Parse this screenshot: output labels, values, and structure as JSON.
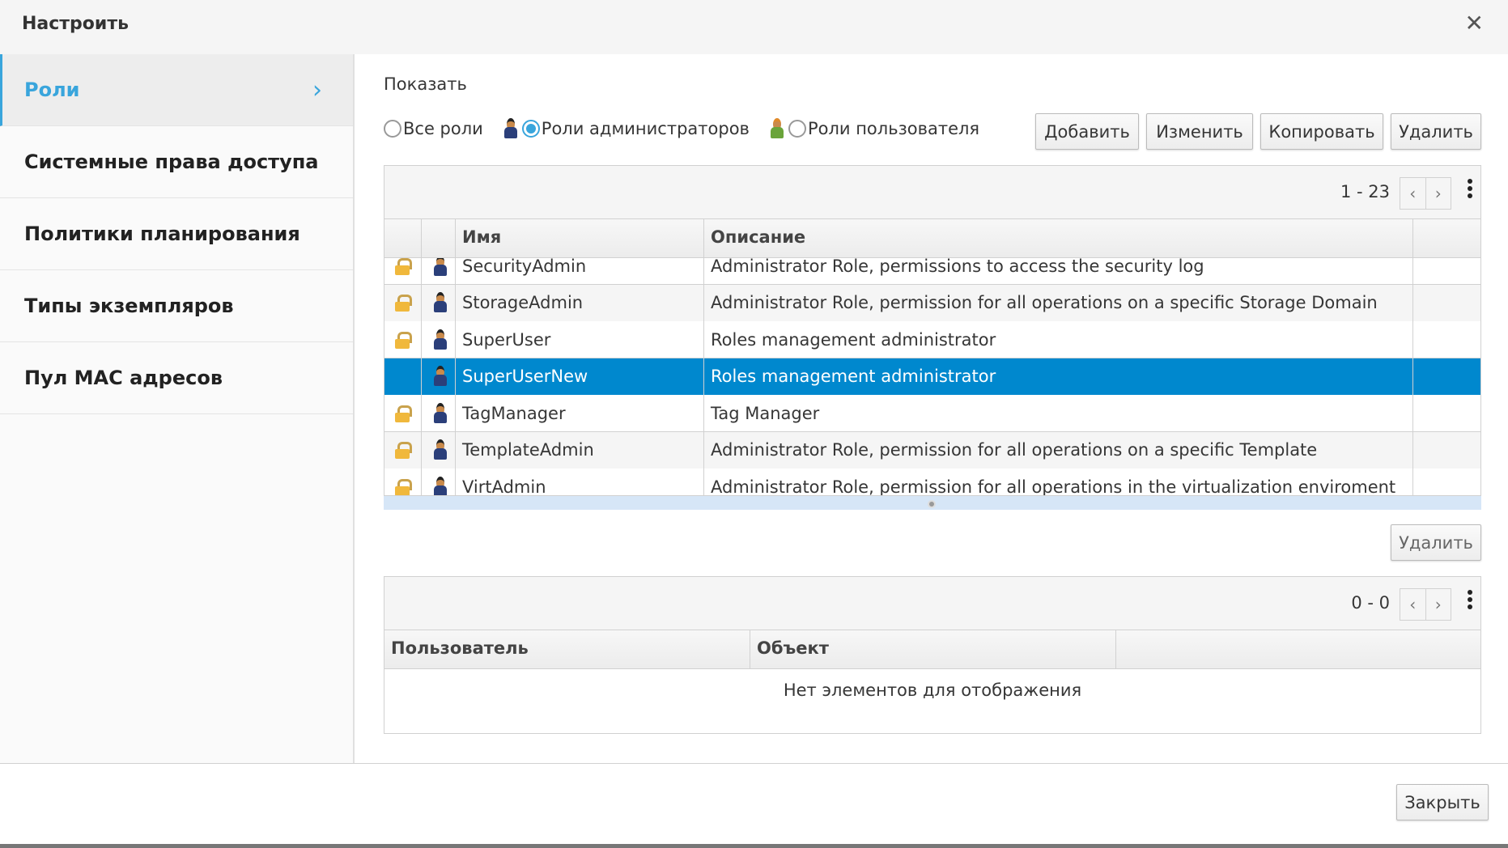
{
  "dialog": {
    "title": "Настроить"
  },
  "sidebar": {
    "items": [
      {
        "label": "Роли"
      },
      {
        "label": "Системные права доступа"
      },
      {
        "label": "Политики планирования"
      },
      {
        "label": "Типы экземпляров"
      },
      {
        "label": "Пул MAC адресов"
      }
    ]
  },
  "show": {
    "label": "Показать",
    "options": [
      "Все роли",
      "Роли администраторов",
      "Роли пользователя"
    ],
    "selected": "Роли администраторов"
  },
  "toolbar": {
    "add": "Добавить",
    "edit": "Изменить",
    "copy": "Копировать",
    "delete": "Удалить"
  },
  "roles_table": {
    "range": "1 - 23",
    "columns": [
      "Имя",
      "Описание"
    ],
    "rows": [
      {
        "name": "SecurityAdmin",
        "description": "Administrator Role, permissions to access the security log",
        "locked": true
      },
      {
        "name": "StorageAdmin",
        "description": "Administrator Role, permission for all operations on a specific Storage Domain",
        "locked": true
      },
      {
        "name": "SuperUser",
        "description": "Roles management administrator",
        "locked": true
      },
      {
        "name": "SuperUserNew",
        "description": "Roles management administrator",
        "locked": false,
        "selected": true
      },
      {
        "name": "TagManager",
        "description": "Tag Manager",
        "locked": true
      },
      {
        "name": "TemplateAdmin",
        "description": "Administrator Role, permission for all operations on a specific Template",
        "locked": true
      },
      {
        "name": "VirtAdmin",
        "description": "Administrator Role, permission for all operations in the virtualization enviroment",
        "locked": true
      }
    ]
  },
  "permissions": {
    "delete": "Удалить",
    "range": "0 - 0",
    "columns": [
      "Пользователь",
      "Объект"
    ],
    "empty": "Нет элементов для отображения"
  },
  "footer": {
    "close": "Закрыть"
  },
  "colors": {
    "accent": "#39a5dc",
    "selected_row": "#0088ce"
  }
}
